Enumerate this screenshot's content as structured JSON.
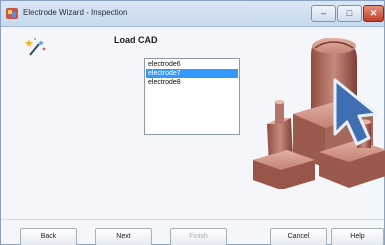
{
  "window": {
    "title": "Electrode Wizard - Inspection",
    "controls": {
      "minimize": "–",
      "maximize": "□",
      "close": "✕"
    }
  },
  "main": {
    "heading": "Load CAD",
    "list_items": [
      "electrode6",
      "electrode7",
      "electrode8"
    ],
    "selected_item": "electrode7"
  },
  "buttons": {
    "back": "Back",
    "next": "Next",
    "finish": "Finish",
    "cancel": "Cancel",
    "help": "Help"
  },
  "colors": {
    "selection": "#3399ff",
    "model": "#b9776b",
    "cursor": "#3f6fb2"
  },
  "icons": {
    "title": "wizard-app-icon",
    "header": "magic-wand-sparkle-icon",
    "illustration": "electrode-3d-model-with-cursor"
  }
}
